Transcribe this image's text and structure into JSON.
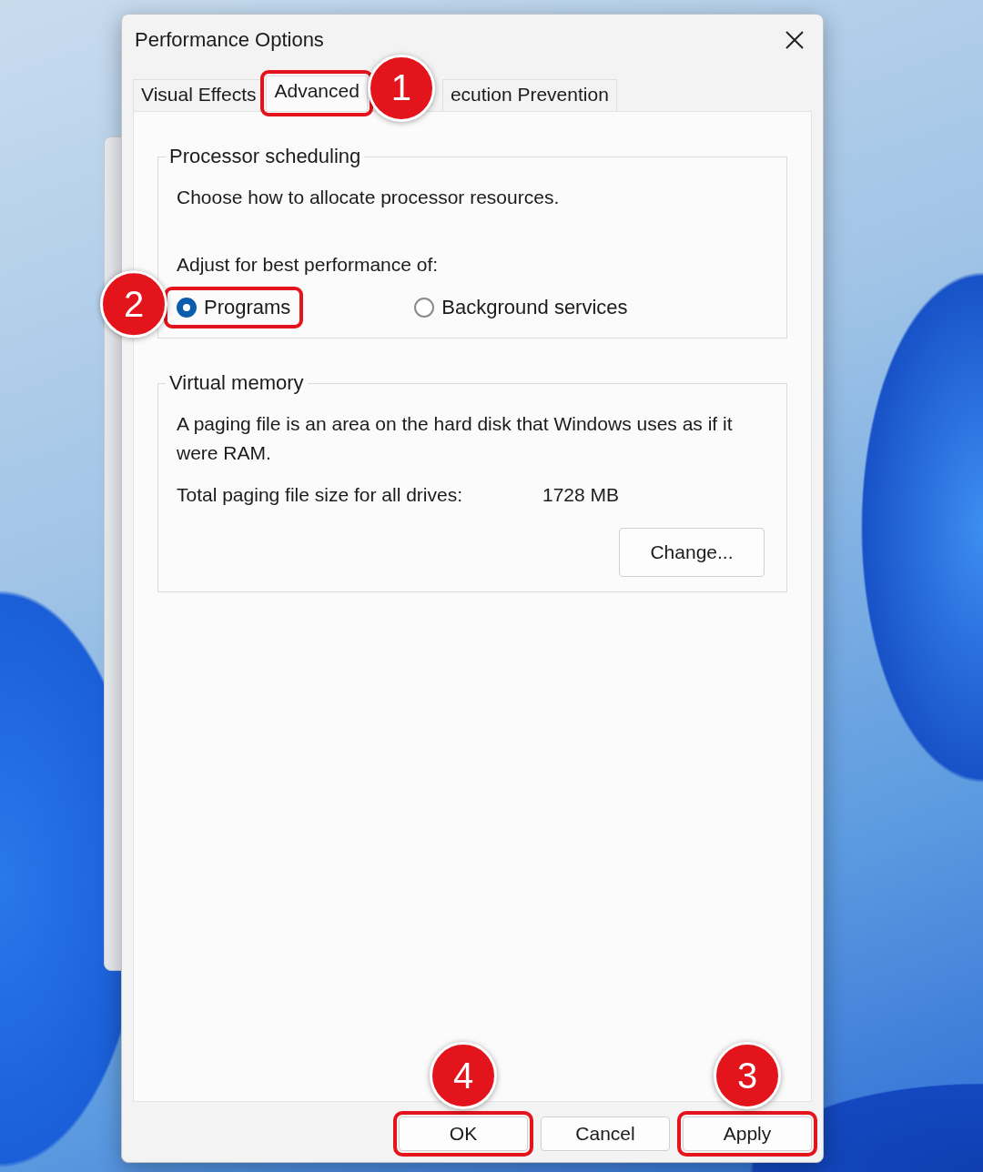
{
  "window": {
    "title": "Performance Options"
  },
  "tabs": [
    {
      "label": "Visual Effects",
      "selected": false,
      "highlighted": false
    },
    {
      "label": "Advanced",
      "selected": true,
      "highlighted": true,
      "callout": {
        "number": "1"
      }
    },
    {
      "label": "ecution Prevention",
      "selected": false,
      "highlighted": false
    }
  ],
  "processor_scheduling": {
    "legend": "Processor scheduling",
    "description": "Choose how to allocate processor resources.",
    "prompt": "Adjust for best performance of:",
    "options": [
      {
        "label": "Programs",
        "selected": true,
        "highlighted": true,
        "callout": {
          "number": "2"
        }
      },
      {
        "label": "Background services",
        "selected": false,
        "highlighted": false
      }
    ]
  },
  "virtual_memory": {
    "legend": "Virtual memory",
    "description": "A paging file is an area on the hard disk that Windows uses as if it were RAM.",
    "size_label": "Total paging file size for all drives:",
    "size_value": "1728 MB",
    "button": "Change..."
  },
  "buttons": [
    {
      "label": "OK",
      "highlighted": true,
      "callout": {
        "number": "4"
      }
    },
    {
      "label": "Cancel",
      "highlighted": false
    },
    {
      "label": "Apply",
      "highlighted": true,
      "callout": {
        "number": "3"
      }
    }
  ]
}
